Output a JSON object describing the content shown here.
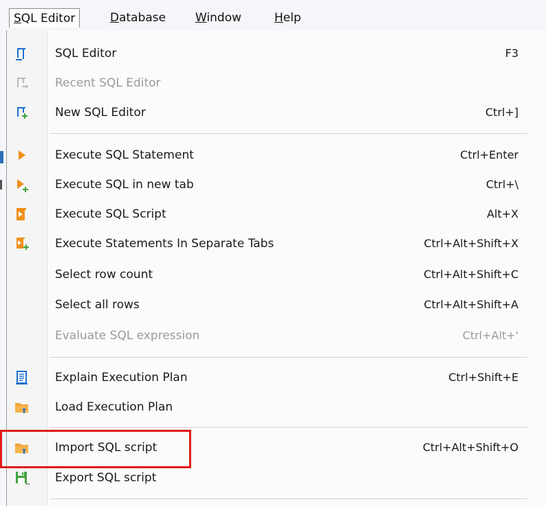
{
  "menubar": {
    "items": [
      {
        "label": "SQL Editor",
        "mnemonic": "S",
        "rest": "QL Editor",
        "active": true
      },
      {
        "label": "Database",
        "mnemonic": "D",
        "rest": "atabase"
      },
      {
        "label": "Window",
        "mnemonic": "W",
        "rest": "indow"
      },
      {
        "label": "Help",
        "mnemonic": "H",
        "rest": "elp"
      }
    ]
  },
  "menu": {
    "items": [
      {
        "label": "SQL Editor",
        "shortcut": "F3",
        "icon": "sql-editor-icon",
        "enabled": true
      },
      {
        "label": "Recent SQL Editor",
        "shortcut": "",
        "icon": "recent-sql-editor-icon",
        "enabled": false
      },
      {
        "label": "New SQL Editor",
        "shortcut": "Ctrl+]",
        "icon": "new-sql-editor-icon",
        "enabled": true
      },
      {
        "label": "Execute SQL Statement",
        "shortcut": "Ctrl+Enter",
        "icon": "execute-play-icon",
        "enabled": true
      },
      {
        "label": "Execute SQL in new tab",
        "shortcut": "Ctrl+\\",
        "icon": "execute-new-tab-icon",
        "enabled": true
      },
      {
        "label": "Execute SQL Script",
        "shortcut": "Alt+X",
        "icon": "execute-script-icon",
        "enabled": true
      },
      {
        "label": "Execute Statements In Separate Tabs",
        "shortcut": "Ctrl+Alt+Shift+X",
        "icon": "execute-separate-tabs-icon",
        "enabled": true
      },
      {
        "label": "Select row count",
        "shortcut": "Ctrl+Alt+Shift+C",
        "icon": "",
        "enabled": true
      },
      {
        "label": "Select all rows",
        "shortcut": "Ctrl+Alt+Shift+A",
        "icon": "",
        "enabled": true
      },
      {
        "label": "Evaluate SQL expression",
        "shortcut": "Ctrl+Alt+'",
        "icon": "",
        "enabled": false
      },
      {
        "label": "Explain Execution Plan",
        "shortcut": "Ctrl+Shift+E",
        "icon": "explain-plan-icon",
        "enabled": true
      },
      {
        "label": "Load Execution Plan",
        "shortcut": "",
        "icon": "folder-load-icon",
        "enabled": true
      },
      {
        "label": "Import SQL script",
        "shortcut": "Ctrl+Alt+Shift+O",
        "icon": "folder-import-icon",
        "enabled": true
      },
      {
        "label": "Export SQL script",
        "shortcut": "",
        "icon": "floppy-export-icon",
        "enabled": true
      }
    ]
  },
  "colors": {
    "accent_blue": "#1e6fd0",
    "orange": "#f0901c",
    "green": "#3fa33f",
    "highlight_red": "#e01b1b"
  }
}
